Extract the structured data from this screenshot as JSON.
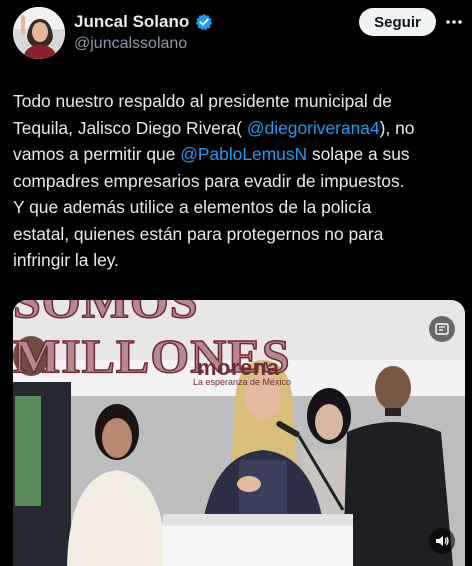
{
  "user": {
    "display_name": "Juncal Solano",
    "handle": "@juncalssolano",
    "follow_label": "Seguir",
    "avatar_icon": "profile-avatar",
    "verified_icon": "verified-badge-icon",
    "verified_color": "#1d9bf0"
  },
  "tweet": {
    "line1": "Todo nuestro respaldo al presidente municipal de",
    "line2_a": "Tequila, Jalisco Diego Rivera( ",
    "line2_mention": "@diegoriverana4",
    "line2_b": "), no",
    "line3_a": "vamos a permitir que ",
    "line3_mention": "@PabloLemusN",
    "line3_b": "  solape a sus",
    "line4": "compadres empresarios para evadir de impuestos.",
    "line5": "Y que además utilice a elementos de la policía",
    "line6": "estatal, quienes están para protegernos no para",
    "line7": "infringir la ley."
  },
  "media": {
    "banner": "SOMOS MILLONES",
    "logo": "morena",
    "logo_tagline": "La esperanza de México",
    "overlay_icon": "gif-icon",
    "sound_icon": "speaker-icon"
  },
  "colors": {
    "background": "#000000",
    "text": "#e7e9ea",
    "secondary": "#8b98a5",
    "link": "#1d9bf0"
  }
}
